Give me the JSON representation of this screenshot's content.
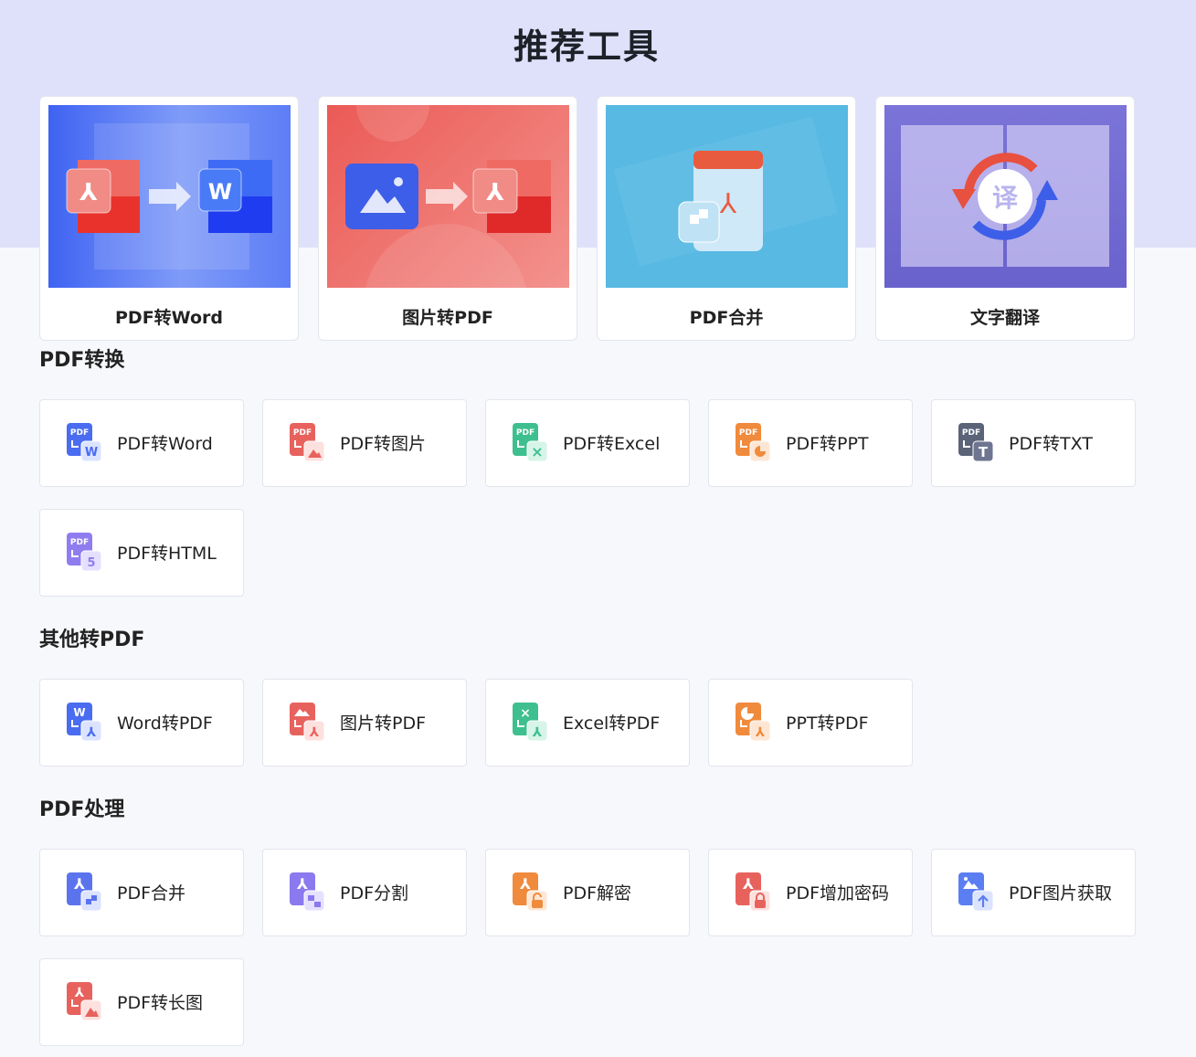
{
  "page": {
    "title": "推荐工具"
  },
  "featured": [
    {
      "label": "PDF转Word"
    },
    {
      "label": "图片转PDF"
    },
    {
      "label": "PDF合并"
    },
    {
      "label": "文字翻译",
      "badge": "译"
    }
  ],
  "sections": [
    {
      "title": "PDF转换",
      "items": [
        {
          "label": "PDF转Word",
          "icon": "pdf-to-word-icon",
          "color": "#4a6cf0",
          "badge": "W"
        },
        {
          "label": "PDF转图片",
          "icon": "pdf-to-image-icon",
          "color": "#e8625d",
          "badge": ""
        },
        {
          "label": "PDF转Excel",
          "icon": "pdf-to-excel-icon",
          "color": "#3ebf8f",
          "badge": "×"
        },
        {
          "label": "PDF转PPT",
          "icon": "pdf-to-ppt-icon",
          "color": "#f08a3c",
          "badge": ""
        },
        {
          "label": "PDF转TXT",
          "icon": "pdf-to-txt-icon",
          "color": "#5a6378",
          "badge": "T"
        },
        {
          "label": "PDF转HTML",
          "icon": "pdf-to-html-icon",
          "color": "#8f7df0",
          "badge": "5"
        }
      ]
    },
    {
      "title": "其他转PDF",
      "items": [
        {
          "label": "Word转PDF",
          "icon": "word-to-pdf-icon",
          "color": "#4a6cf0"
        },
        {
          "label": "图片转PDF",
          "icon": "image-to-pdf-icon",
          "color": "#e8625d"
        },
        {
          "label": "Excel转PDF",
          "icon": "excel-to-pdf-icon",
          "color": "#3ebf8f"
        },
        {
          "label": "PPT转PDF",
          "icon": "ppt-to-pdf-icon",
          "color": "#f08a3c"
        }
      ]
    },
    {
      "title": "PDF处理",
      "items": [
        {
          "label": "PDF合并",
          "icon": "pdf-merge-icon",
          "color": "#5b74ee"
        },
        {
          "label": "PDF分割",
          "icon": "pdf-split-icon",
          "color": "#8a79ef"
        },
        {
          "label": "PDF解密",
          "icon": "pdf-decrypt-icon",
          "color": "#f08a3c"
        },
        {
          "label": "PDF增加密码",
          "icon": "pdf-add-password-icon",
          "color": "#e8625d"
        },
        {
          "label": "PDF图片获取",
          "icon": "pdf-extract-images-icon",
          "color": "#5b7ef2"
        },
        {
          "label": "PDF转长图",
          "icon": "pdf-to-long-image-icon",
          "color": "#e8625d"
        }
      ]
    }
  ],
  "colors": {
    "band": "#dfe1fb",
    "background": "#f7f8fb",
    "card_border": "#e3e5ee"
  }
}
